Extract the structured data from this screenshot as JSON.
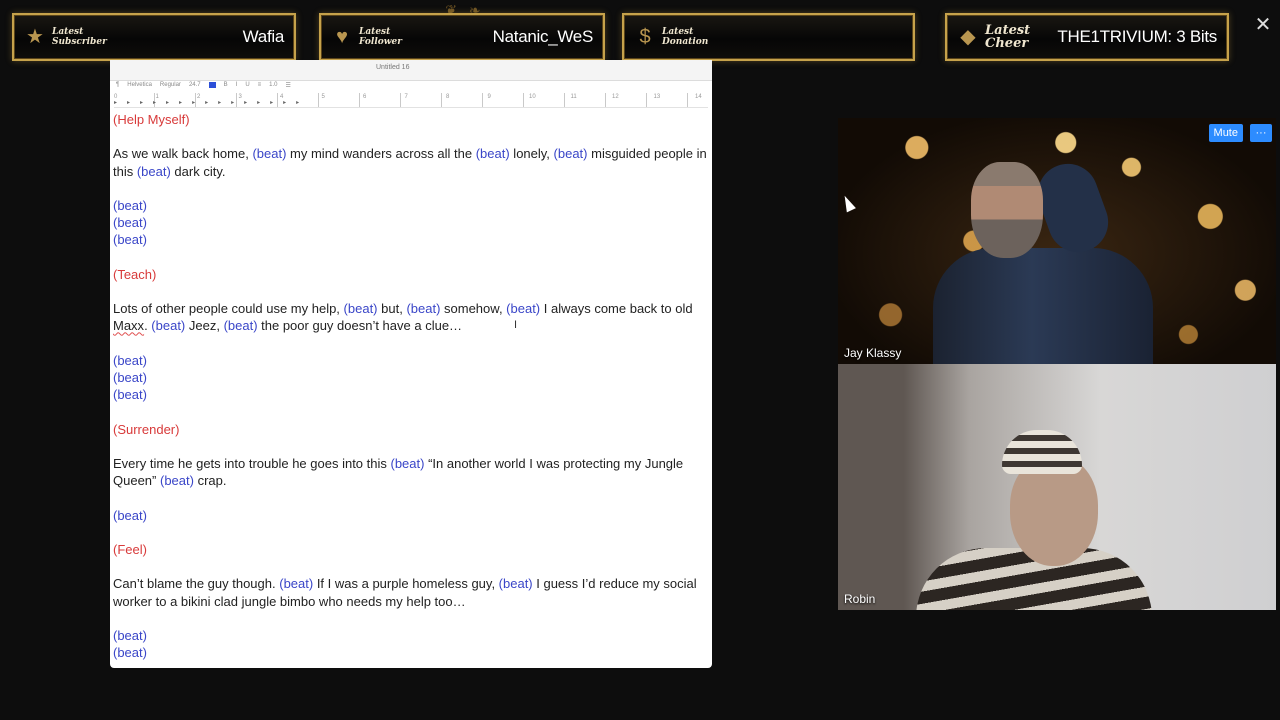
{
  "alerts": {
    "subscriber": {
      "label": "Latest\nSubscriber",
      "value": "Wafia",
      "icon": "star-icon"
    },
    "follower": {
      "label": "Latest\nFollower",
      "value": "Natanic_WeS",
      "icon": "heart-icon"
    },
    "donation": {
      "label": "Latest\nDonation",
      "value": "",
      "icon": "dollar-icon"
    },
    "cheer": {
      "label": "Latest\nCheer",
      "value": "THE1TRIVIUM: 3 Bits",
      "icon": "diamond-icon"
    }
  },
  "close_glyph": "✕",
  "document": {
    "window_title": "Untitled 16",
    "toolbar": {
      "font": "Helvetica",
      "style": "Regular",
      "size": "24.7",
      "spacing": "1.0"
    },
    "ruler_numbers": [
      "0",
      "1",
      "2",
      "3",
      "4",
      "5",
      "6",
      "7",
      "8",
      "9",
      "10",
      "11",
      "12",
      "13",
      "14"
    ],
    "lines": {
      "h1": "(Help Myself)",
      "p1a": "As we walk back home, ",
      "p1b": "(beat)",
      "p1c": " my mind wanders across all the ",
      "p1d": "(beat)",
      "p1e": " lonely, ",
      "p1f": "(beat)",
      "p1g": " misguided people in this ",
      "p1h": "(beat)",
      "p1i": " dark city.",
      "b1": "(beat)",
      "b2": "(beat)",
      "b3": "(beat)",
      "h2": "(Teach)",
      "p2a": "Lots of other people could use my help, ",
      "p2b": "(beat)",
      "p2c": " but, ",
      "p2d": "(beat)",
      "p2e": " somehow, ",
      "p2f": "(beat)",
      "p2g": " I always come back to old ",
      "p2h": "Maxx",
      "p2i": ". ",
      "p2j": "(beat)",
      "p2k": " Jeez, ",
      "p2l": "(beat)",
      "p2m": " the poor guy doesn’t have a clue…",
      "b4": "(beat)",
      "b5": "(beat)",
      "b6": "(beat)",
      "h3": "(Surrender)",
      "p3a": "Every time he gets into trouble he goes into this ",
      "p3b": "(beat)",
      "p3c": " “In another world I was protecting my Jungle Queen” ",
      "p3d": "(beat)",
      "p3e": " crap.",
      "b7": "(beat)",
      "h4": "(Feel)",
      "p4a": "Can’t blame the guy though. ",
      "p4b": "(beat)",
      "p4c": " If I was a purple homeless guy, ",
      "p4d": "(beat)",
      "p4e": " I guess I’d reduce my social worker to a bikini clad jungle bimbo who needs my help too…",
      "b8": "(beat)",
      "b9": "(beat)"
    }
  },
  "video": {
    "tile1_name": "Jay Klassy",
    "tile2_name": "Robin",
    "mute_label": "Mute",
    "more_label": "···"
  },
  "colors": {
    "alert_border": "#c6a24b",
    "heading_red": "#d83a3a",
    "beat_blue": "#3a46c8",
    "zoom_blue": "#2d8cff"
  }
}
